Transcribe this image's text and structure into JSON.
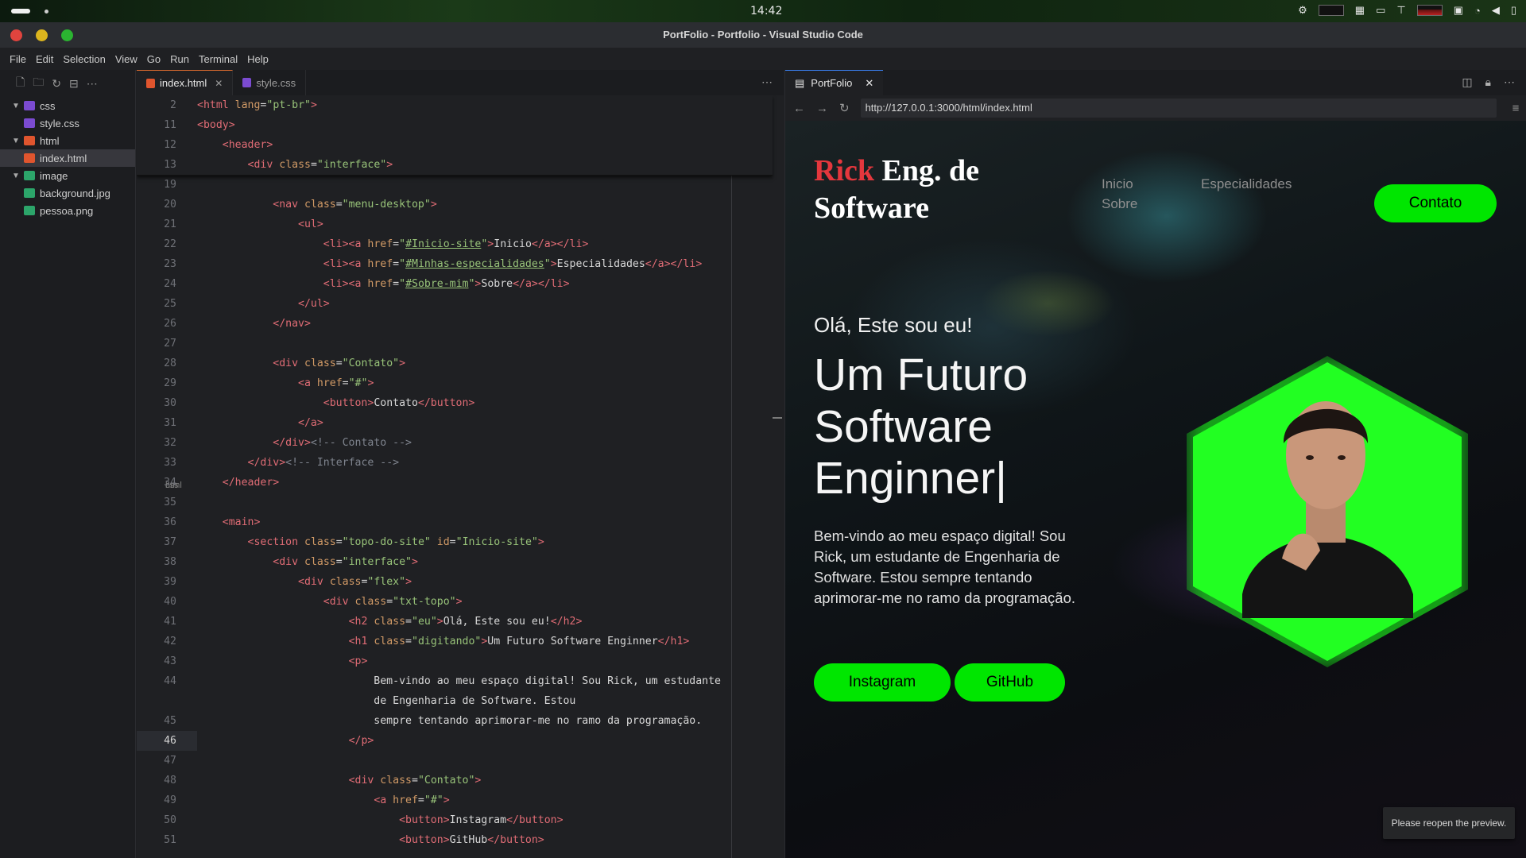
{
  "os": {
    "clock": "14:42"
  },
  "window": {
    "title": "PortFolio - Portfolio - Visual Studio Code"
  },
  "menu": [
    "File",
    "Edit",
    "Selection",
    "View",
    "Go",
    "Run",
    "Terminal",
    "Help"
  ],
  "explorer": {
    "tree": [
      {
        "label": "css",
        "type": "folder",
        "depth": 0,
        "icon": "folder-css-icon"
      },
      {
        "label": "style.css",
        "type": "file",
        "depth": 1,
        "icon": "css-file-icon"
      },
      {
        "label": "html",
        "type": "folder",
        "depth": 0,
        "icon": "folder-html-icon"
      },
      {
        "label": "index.html",
        "type": "file",
        "depth": 1,
        "icon": "html-file-icon",
        "selected": true
      },
      {
        "label": "image",
        "type": "folder",
        "depth": 0,
        "icon": "folder-image-icon"
      },
      {
        "label": "background.jpg",
        "type": "file",
        "depth": 1,
        "icon": "image-file-icon"
      },
      {
        "label": "pessoa.png",
        "type": "file",
        "depth": 1,
        "icon": "image-file-icon"
      }
    ]
  },
  "editor": {
    "tabs": [
      {
        "label": "index.html",
        "desc": "html",
        "active": true
      },
      {
        "label": "style.css",
        "desc": "css",
        "active": false
      }
    ],
    "current_line": "46"
  },
  "preview": {
    "tab_label": "PortFolio",
    "url": "http://127.0.0.1:3000/html/index.html",
    "site": {
      "logo_first": "Rick",
      "logo_rest": " Eng. de Software",
      "nav": [
        "Inicio",
        "Especialidades",
        "Sobre"
      ],
      "contact_button": "Contato",
      "greeting": "Olá, Este sou eu!",
      "headline": "Um Futuro Software Enginner|",
      "description": "Bem-vindo ao meu espaço digital! Sou Rick, um estudante de Engenharia de Software. Estou sempre tentando aprimorar-me no ramo da programação.",
      "instagram_button": "Instagram",
      "github_button": "GitHub"
    },
    "toast": "Please reopen the preview."
  },
  "colors": {
    "accent_green": "#00e600",
    "logo_red": "#e4373d"
  }
}
